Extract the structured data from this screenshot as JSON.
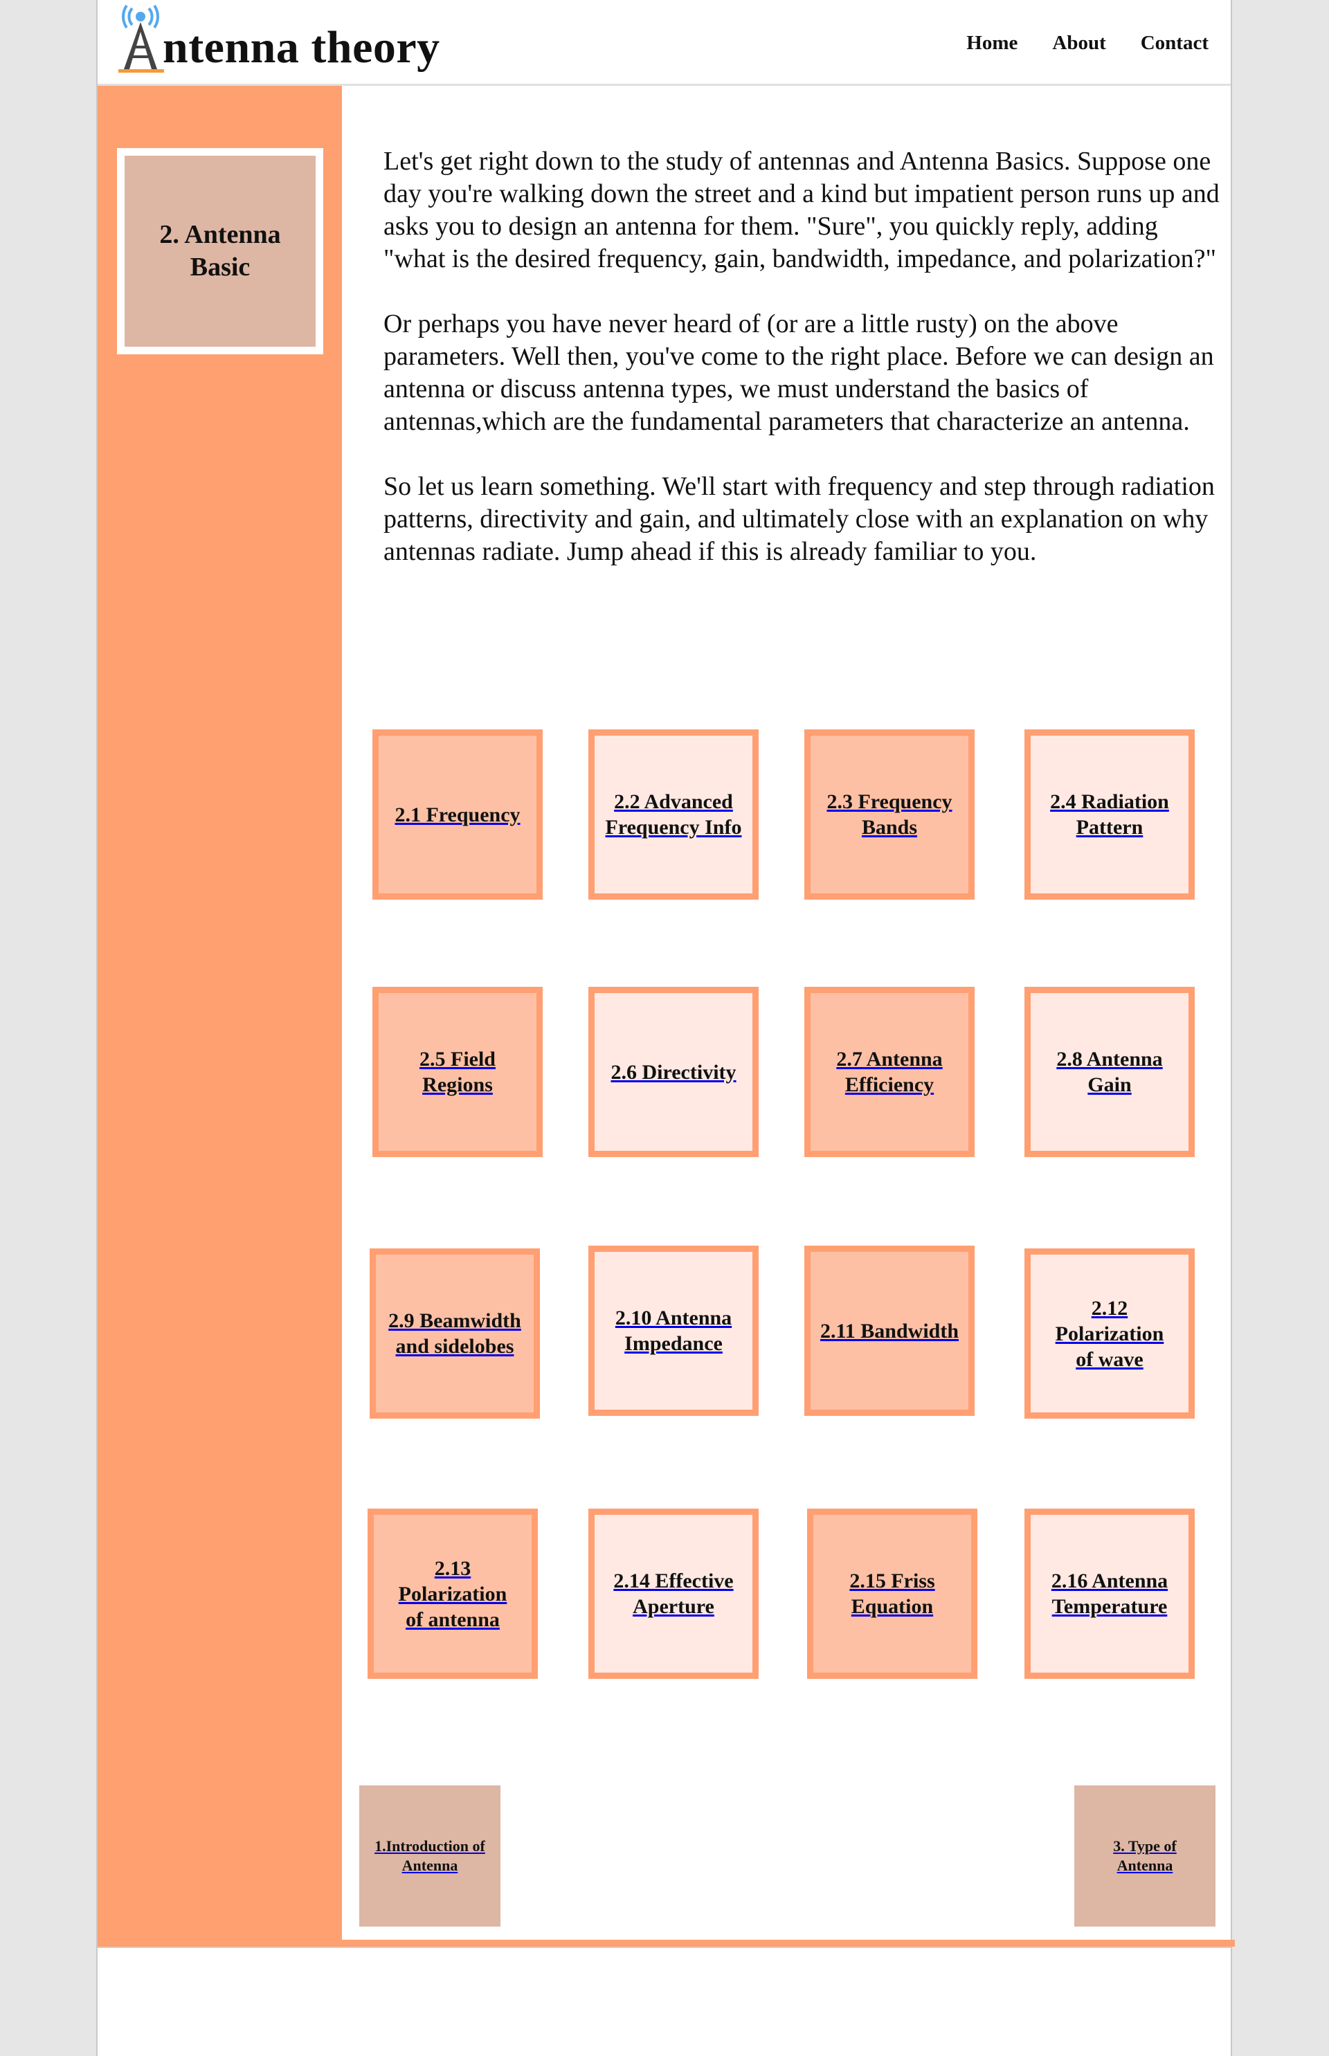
{
  "header": {
    "site_title_rest": "ntenna theory",
    "nav": [
      "Home",
      "About",
      "Contact"
    ]
  },
  "sidebar": {
    "chapter_line1": "2. Antenna",
    "chapter_line2": "Basic"
  },
  "main": {
    "paragraphs": [
      "Let's get right down to the study of antennas and Antenna Basics. Suppose one day you're walking down the street and a kind but impatient person runs up and asks you to design an antenna for them. \"Sure\", you quickly reply, adding \"what is the desired frequency, gain, bandwidth, impedance, and polarization?\"",
      "Or perhaps you have never heard of (or are a little rusty) on the above parameters. Well then, you've come to the right place. Before we can design an antenna or discuss antenna types, we must understand the basics of antennas,which are the fundamental parameters that characterize an antenna.",
      "So let us learn something. We'll start with frequency and step through radiation patterns, directivity and gain, and ultimately close with an explanation on why antennas radiate. Jump ahead if this is already familiar to you."
    ],
    "topics": [
      {
        "l1": "2.1 Frequency",
        "l2": ""
      },
      {
        "l1": "2.2 Advanced",
        "l2": "Frequency Info"
      },
      {
        "l1": "2.3 Frequency",
        "l2": "Bands"
      },
      {
        "l1": "2.4 Radiation",
        "l2": "Pattern"
      },
      {
        "l1": "2.5 Field",
        "l2": "Regions"
      },
      {
        "l1": "2.6 Directivity",
        "l2": ""
      },
      {
        "l1": "2.7 Antenna",
        "l2": "Efficiency"
      },
      {
        "l1": "2.8 Antenna",
        "l2": "Gain"
      },
      {
        "l1": "2.9 Beamwidth",
        "l2": "and sidelobes"
      },
      {
        "l1": "2.10 Antenna",
        "l2": "Impedance"
      },
      {
        "l1": "2.11 Bandwidth",
        "l2": ""
      },
      {
        "l1": "2.12 Polarization",
        "l2": "of wave"
      },
      {
        "l1": "2.13 Polarization",
        "l2": "of antenna"
      },
      {
        "l1": "2.14 Effective",
        "l2": "Aperture"
      },
      {
        "l1": "2.15 Friss",
        "l2": "Equation"
      },
      {
        "l1": "2.16 Antenna",
        "l2": "Temperature"
      }
    ],
    "prev": {
      "l1": "1.Introduction of",
      "l2": "Antenna"
    },
    "next": {
      "l1": "3. Type of",
      "l2": "Antenna"
    }
  },
  "colors": {
    "sidebar": "#ffa070",
    "tile_dark": "#fec0a4",
    "tile_light": "#ffe9e2",
    "tile_border": "#ff9f72",
    "chapter_box": "#deb6a4"
  },
  "icons": {
    "logo": "antenna-tower-icon"
  }
}
